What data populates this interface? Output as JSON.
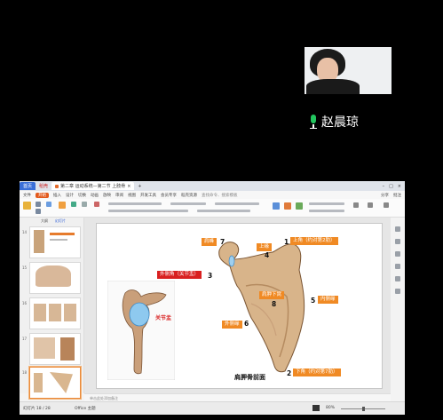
{
  "video": {
    "speaker_name": "赵晨琼"
  },
  "titlebar": {
    "home_tab": "首页",
    "wps_tab": "稻壳",
    "doc_tab": "第二章 运动系统—第二节 上肢骨",
    "add_tab": "+"
  },
  "menubar": {
    "items": [
      "文件",
      "开始",
      "插入",
      "设计",
      "切换",
      "动画",
      "放映",
      "审阅",
      "视图",
      "开发工具",
      "会员专享",
      "稻壳资源"
    ],
    "search": "查找命令、搜索模板",
    "right_items": [
      "分享",
      "批注"
    ]
  },
  "panel": {
    "tabs": [
      "大纲",
      "幻灯片"
    ],
    "slide_numbers": [
      "14",
      "15",
      "16",
      "17",
      "18"
    ]
  },
  "slide": {
    "title": "肩胛骨前面",
    "labels": {
      "acromion": "肩峰",
      "superior_border": "上缘",
      "superior_angle": "上角（约对第2肋）",
      "lateral_angle": "外侧角（关节盂）",
      "subscapular_fossa": "肩胛下窝",
      "medial_border": "内侧缘",
      "lateral_border": "外侧缘",
      "inferior_angle": "下角（约对第7肋）",
      "glenoid_cavity": "关节盂"
    },
    "numbers": [
      "7",
      "4",
      "1",
      "3",
      "8",
      "5",
      "6",
      "2"
    ]
  },
  "notes": {
    "placeholder": "单击此处添加备注"
  },
  "statusbar": {
    "slide_info": "幻灯片 18 / 28",
    "theme": "Office 主题",
    "zoom": "80%"
  }
}
